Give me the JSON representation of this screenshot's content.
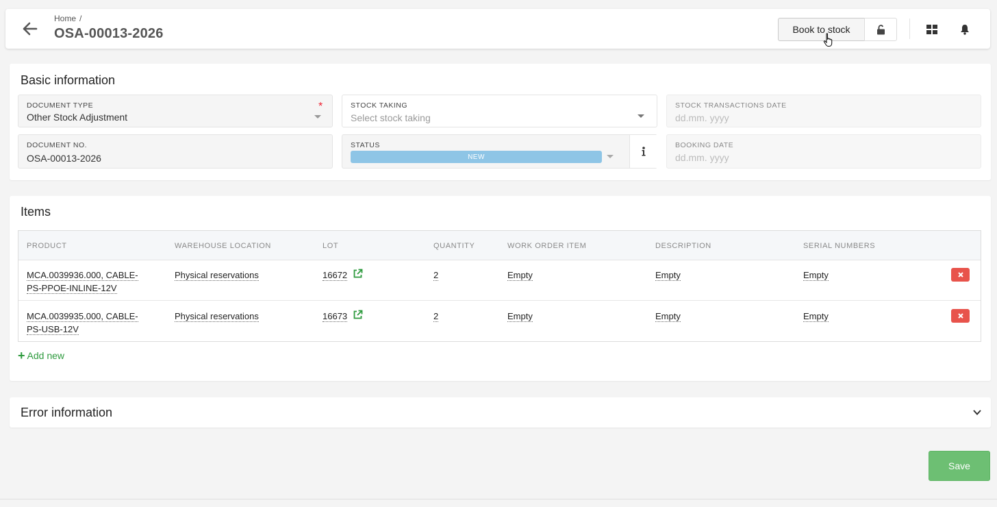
{
  "header": {
    "breadcrumb_home": "Home",
    "breadcrumb_separator": "/",
    "title": "OSA-00013-2026",
    "book_to_stock_label": "Book to stock",
    "icons": [
      "arrow-left-icon",
      "unlock-icon",
      "grid-icon",
      "bell-icon"
    ]
  },
  "basic_info": {
    "title": "Basic information",
    "document_type": {
      "label": "DOCUMENT TYPE",
      "value": "Other Stock Adjustment",
      "required_mark": "*"
    },
    "stock_taking": {
      "label": "STOCK TAKING",
      "placeholder": "Select stock taking"
    },
    "stock_transactions_date": {
      "label": "STOCK TRANSACTIONS DATE",
      "placeholder": "dd.mm. yyyy"
    },
    "document_no": {
      "label": "DOCUMENT NO.",
      "value": "OSA-00013-2026"
    },
    "status": {
      "label": "STATUS",
      "value": "NEW",
      "color": "#8ec5e6"
    },
    "booking_date": {
      "label": "BOOKING DATE",
      "placeholder": "dd.mm. yyyy"
    }
  },
  "items": {
    "title": "Items",
    "columns": [
      "PRODUCT",
      "WAREHOUSE LOCATION",
      "LOT",
      "QUANTITY",
      "WORK ORDER ITEM",
      "DESCRIPTION",
      "SERIAL NUMBERS"
    ],
    "rows": [
      {
        "product_line1": "MCA.0039936.000, CABLE-",
        "product_line2": "PS-PPOE-INLINE-12V",
        "warehouse_location": "Physical reservations",
        "lot": "16672",
        "quantity": "2",
        "work_order_item": "Empty",
        "description": "Empty",
        "serial_numbers": "Empty"
      },
      {
        "product_line1": "MCA.0039935.000, CABLE-",
        "product_line2": "PS-USB-12V",
        "warehouse_location": "Physical reservations",
        "lot": "16673",
        "quantity": "2",
        "work_order_item": "Empty",
        "description": "Empty",
        "serial_numbers": "Empty"
      }
    ],
    "add_new_label": "Add new",
    "add_color": "#2d9a3d",
    "delete_color": "#e8534b"
  },
  "error_info": {
    "title": "Error information"
  },
  "footer": {
    "save_label": "Save",
    "save_color": "#6dbf73"
  }
}
